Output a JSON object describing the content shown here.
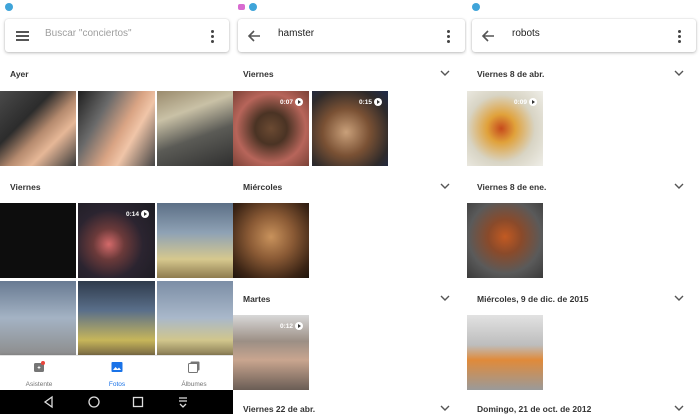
{
  "colors": {
    "accent": "#1a73e8",
    "status_icon": "#3fa4d9"
  },
  "panels": [
    {
      "search": {
        "placeholder": "Buscar \"conciertos\""
      },
      "sections": [
        {
          "label": "Ayer"
        },
        {
          "label": "Viernes"
        }
      ],
      "thumbnails": [
        {
          "name": "photo-hand-laptop-1"
        },
        {
          "name": "photo-hand-laptop-2"
        },
        {
          "name": "photo-laptop-screen"
        },
        {
          "name": "photo-dark"
        },
        {
          "name": "video-sparkle",
          "duration": "0:14"
        },
        {
          "name": "photo-monitor-1"
        },
        {
          "name": "photo-monitor-2"
        },
        {
          "name": "photo-monitor-3"
        },
        {
          "name": "photo-monitor-4"
        }
      ],
      "bottom_nav": [
        {
          "label": "Asistente",
          "icon": "assistant-icon"
        },
        {
          "label": "Fotos",
          "icon": "photos-icon",
          "active": true
        },
        {
          "label": "Álbumes",
          "icon": "albums-icon"
        }
      ],
      "system_nav": [
        "back-icon",
        "home-icon",
        "recents-icon",
        "notification-pull-icon"
      ]
    },
    {
      "search": {
        "query": "hamster"
      },
      "sections": [
        {
          "label": "Viernes"
        },
        {
          "label": "Miércoles"
        },
        {
          "label": "Martes"
        },
        {
          "label": "Viernes 22 de abr."
        }
      ],
      "thumbnails": [
        {
          "name": "video-hamster-1",
          "duration": "0:07"
        },
        {
          "name": "video-hamster-2",
          "duration": "0:15"
        },
        {
          "name": "photo-hamster-bedding"
        },
        {
          "name": "video-hamster-cage",
          "duration": "0:12"
        }
      ]
    },
    {
      "search": {
        "query": "robots"
      },
      "sections": [
        {
          "label": "Viernes 8 de abr."
        },
        {
          "label": "Viernes 8 de ene."
        },
        {
          "label": "Miércoles, 9 de dic. de 2015"
        },
        {
          "label": "Domingo, 21 de oct. de 2012"
        }
      ],
      "thumbnails": [
        {
          "name": "video-robot-lego",
          "duration": "0:09"
        },
        {
          "name": "photo-robot-lego-2"
        },
        {
          "name": "photo-astronaut-figures"
        }
      ]
    }
  ]
}
